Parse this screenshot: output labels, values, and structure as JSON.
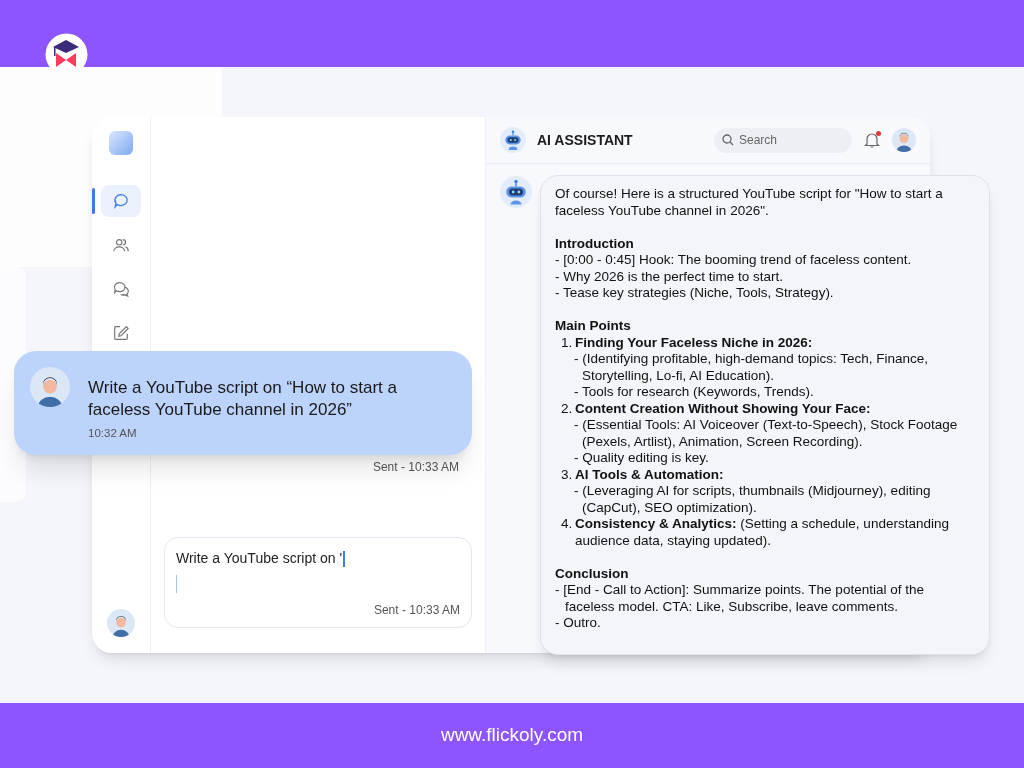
{
  "header": {
    "title": "AI ASSISTANT",
    "search": {
      "placeholder": "Search"
    },
    "notifications": {
      "unread": true
    }
  },
  "nav": [
    {
      "kind": "chat",
      "selected": true
    },
    {
      "kind": "people",
      "selected": false
    },
    {
      "kind": "chats",
      "selected": false
    },
    {
      "kind": "edit",
      "selected": false
    }
  ],
  "chat": {
    "sent_status": "Sent - 10:33 AM",
    "composer": {
      "value": "Write a YouTube script on '",
      "status": "Sent - 10:33 AM"
    }
  },
  "user_message": {
    "text": "Write a YouTube script on “How to start a faceless YouTube channel in 2026”",
    "time": "10:32 AM"
  },
  "response": {
    "intro": "Of course! Here is a structured YouTube script for \"How to start a faceless YouTube channel in 2026\".",
    "sections": [
      {
        "heading": "Introduction",
        "items": [
          {
            "kind": "bullet",
            "text": "- [0:00 - 0:45] Hook: The booming trend of faceless content."
          },
          {
            "kind": "bullet",
            "text": "- Why 2026 is the perfect time to start."
          },
          {
            "kind": "bullet",
            "text": "- Tease key strategies (Niche, Tools, Strategy)."
          }
        ]
      },
      {
        "heading": "Main Points",
        "items": [
          {
            "kind": "numbered",
            "number": "1.",
            "title": "Finding Your Faceless Niche in 2026:",
            "children": [
              "- (Identifying profitable, high-demand topics: Tech, Finance, Storytelling, Lo-fi, AI Education).",
              "- Tools for research (Keywords, Trends)."
            ]
          },
          {
            "kind": "numbered",
            "number": "2.",
            "title": "Content Creation Without Showing Your Face:",
            "children": [
              "- (Essential Tools: AI Voiceover (Text-to-Speech), Stock Footage (Pexels, Artlist), Animation, Screen Recording).",
              "- Quality editing is key."
            ]
          },
          {
            "kind": "numbered",
            "number": "3.",
            "title": "AI Tools & Automation:",
            "children": [
              "- (Leveraging AI for scripts, thumbnails (Midjourney), editing (CapCut), SEO optimization)."
            ]
          },
          {
            "kind": "numbered",
            "number": "4.",
            "title": "Consistency & Analytics:",
            "text": "(Setting a schedule, understanding audience data, staying updated)."
          }
        ]
      },
      {
        "heading": "Conclusion",
        "items": [
          {
            "kind": "bullet",
            "text": "- [End - Call to Action]: Summarize points. The potential of the faceless model. CTA: Like, Subscribe, leave comments."
          },
          {
            "kind": "bullet",
            "text": "- Outro."
          }
        ]
      }
    ]
  },
  "footer": {
    "url": "www.flickoly.com"
  }
}
